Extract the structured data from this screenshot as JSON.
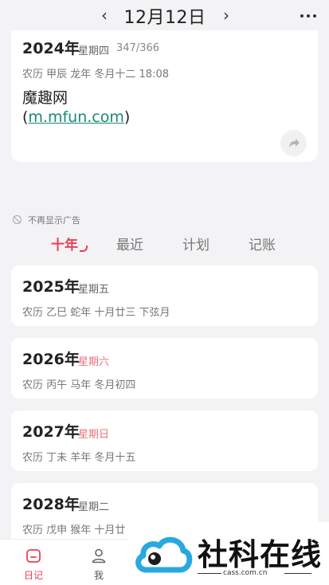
{
  "header": {
    "date_title": "12月12日",
    "prev_icon": "chevron-left-icon",
    "next_icon": "chevron-right-icon",
    "more_icon": "more-dots-icon"
  },
  "today": {
    "year": "2024年",
    "weekday": "星期四",
    "day_of_year": "347/366",
    "lunar": "农历  甲辰 龙年 冬月十二  18:08",
    "ad_title": "魔趣网",
    "ad_link_open": "(",
    "ad_link_text": "m.mfun.com",
    "ad_link_close": ")",
    "share_icon": "share-icon"
  },
  "no_ad_label": "不再显示广告",
  "tabs": [
    {
      "label": "十年",
      "active": true
    },
    {
      "label": "最近",
      "active": false
    },
    {
      "label": "计划",
      "active": false
    },
    {
      "label": "记账",
      "active": false
    }
  ],
  "years": [
    {
      "year": "2025年",
      "weekday": "星期五",
      "weekend": false,
      "lunar": "农历  乙巳 蛇年 十月廿三 下弦月"
    },
    {
      "year": "2026年",
      "weekday": "星期六",
      "weekend": true,
      "lunar": "农历  丙午 马年 冬月初四"
    },
    {
      "year": "2027年",
      "weekday": "星期日",
      "weekend": true,
      "lunar": "农历  丁未 羊年 冬月十五"
    },
    {
      "year": "2028年",
      "weekday": "星期二",
      "weekend": false,
      "lunar": "农历  戊申 猴年 十月廿"
    }
  ],
  "bottom_nav": [
    {
      "label": "日记",
      "icon": "calendar-home-icon",
      "active": true
    },
    {
      "label": "我",
      "icon": "person-icon",
      "active": false
    }
  ],
  "watermark": {
    "title": "社科在线",
    "subtitle": "cass.com.cn",
    "accent": "#29a8e0"
  },
  "colors": {
    "accent": "#e84057",
    "weekend": "#e8717d",
    "link": "#1a8a76"
  }
}
